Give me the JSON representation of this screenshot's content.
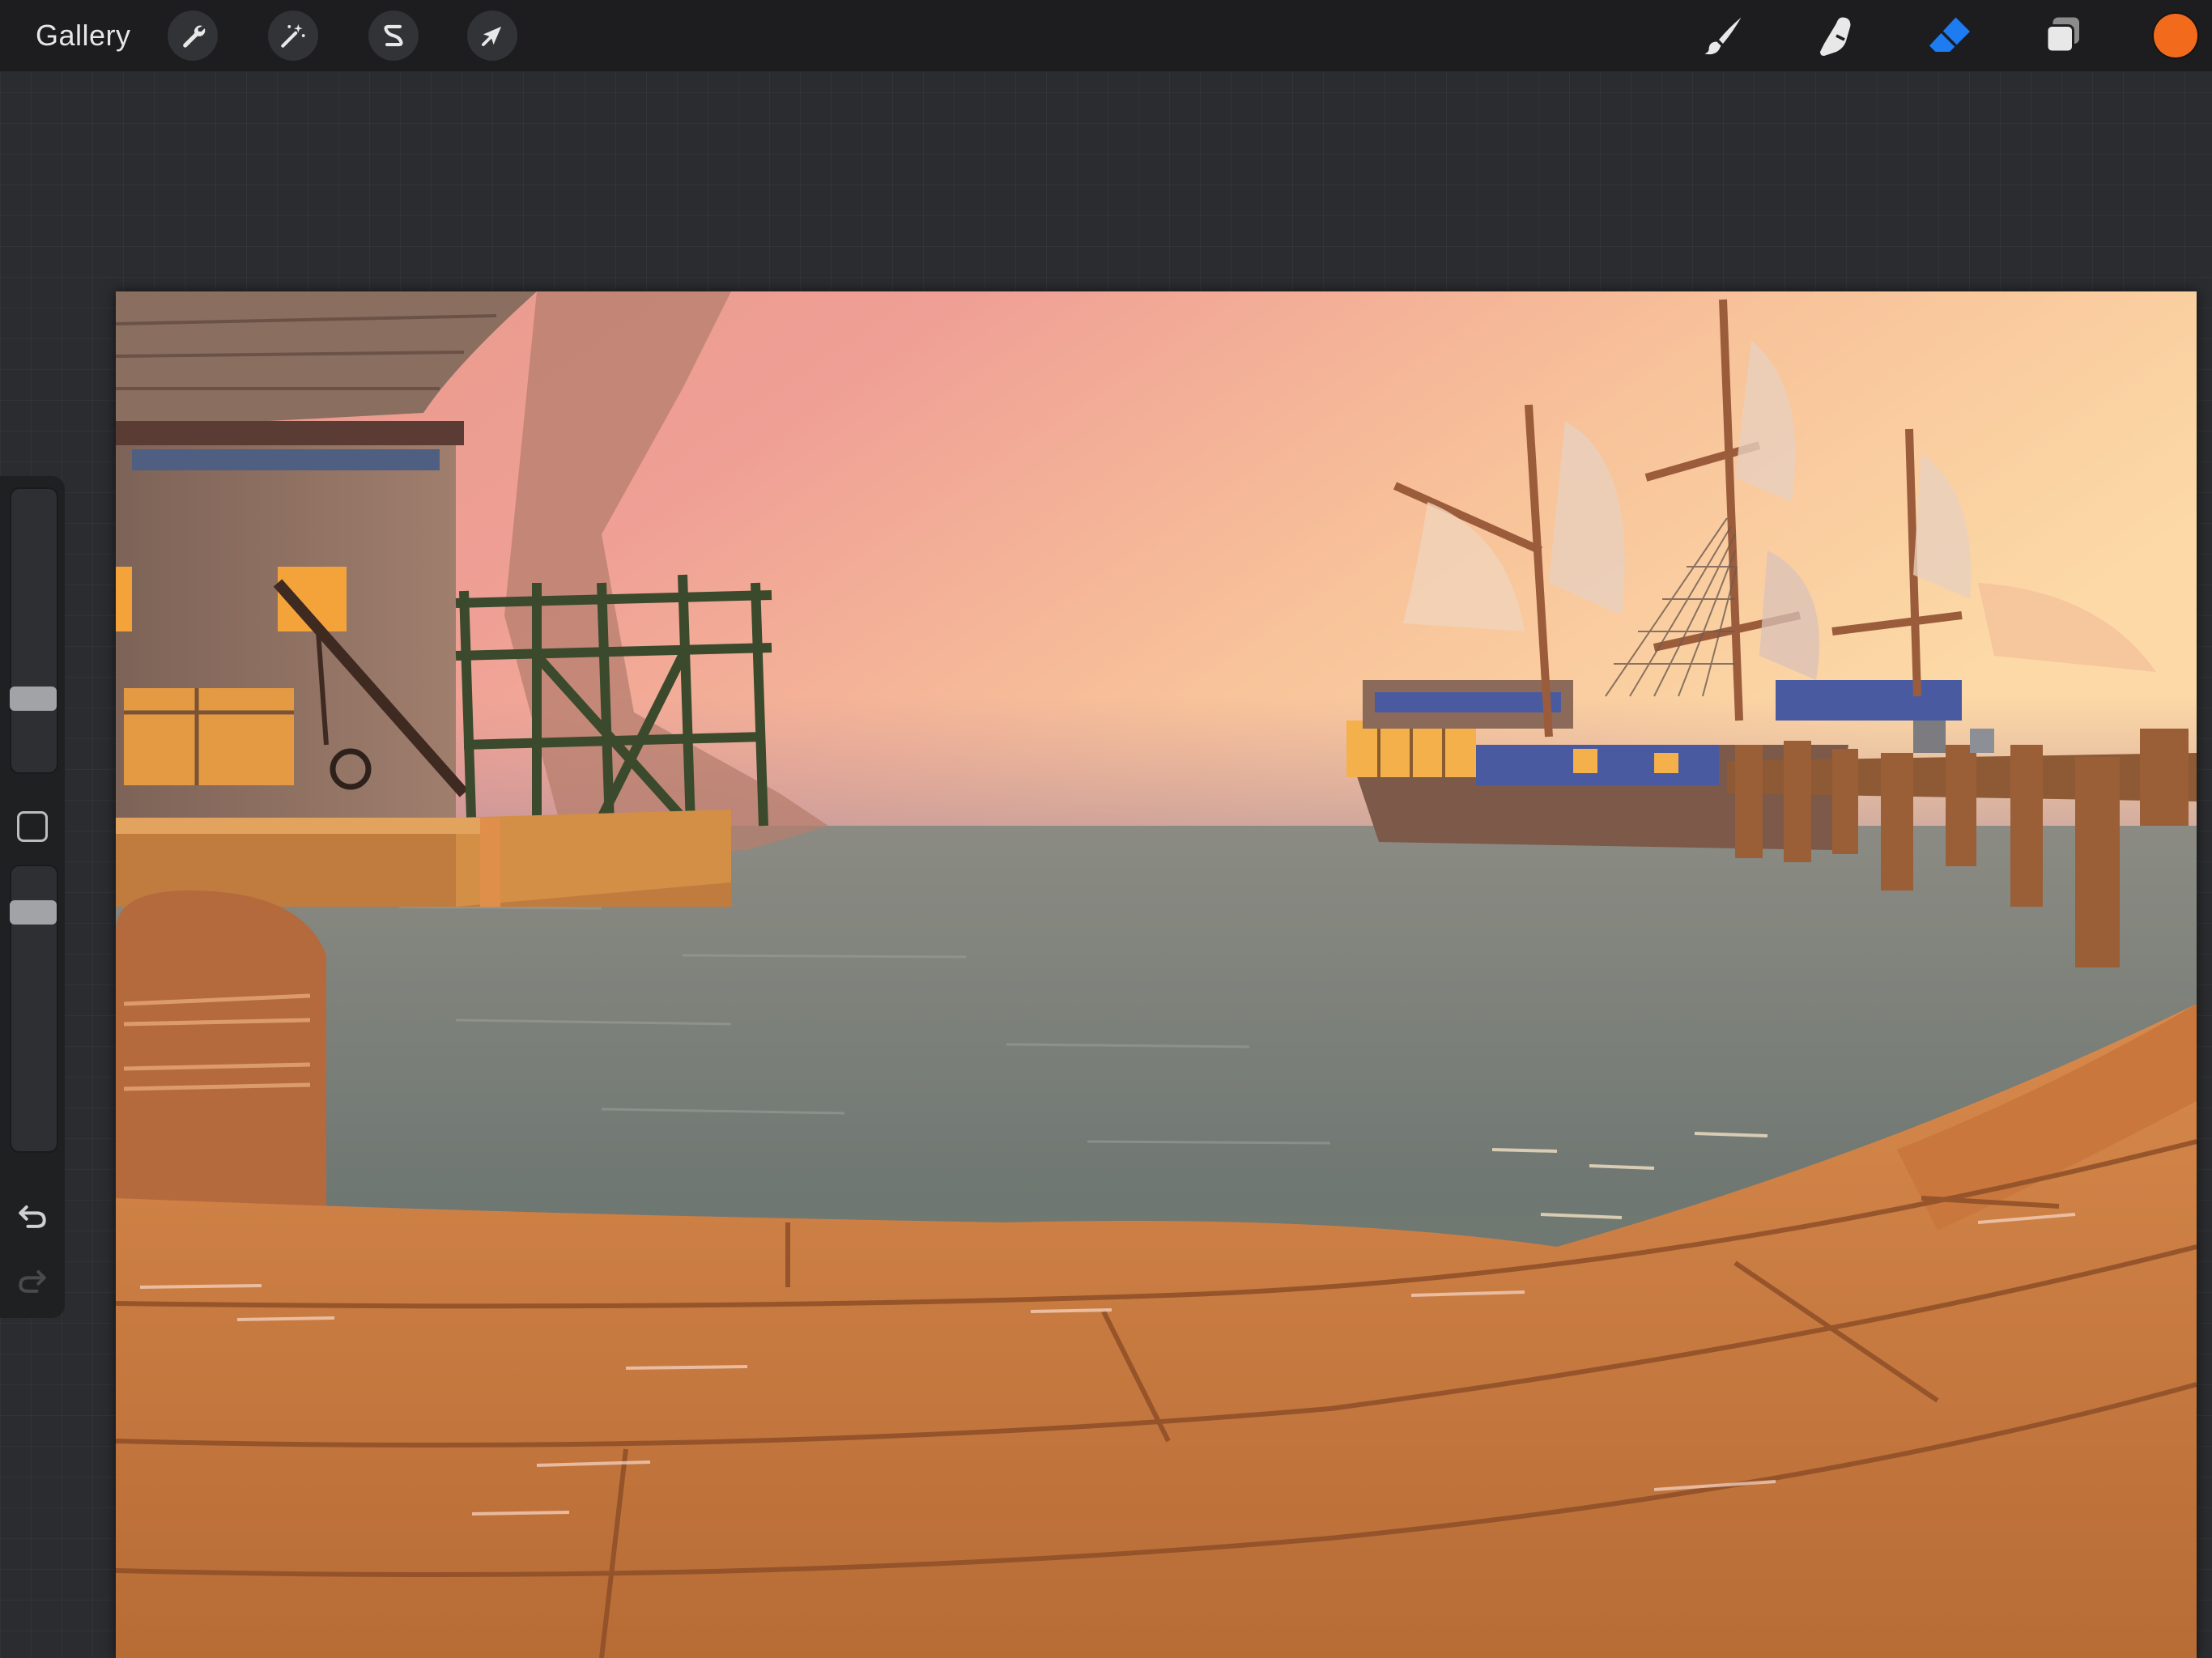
{
  "toolbar": {
    "gallery_label": "Gallery",
    "left_tools": [
      {
        "name": "actions",
        "icon": "wrench-icon"
      },
      {
        "name": "adjustments",
        "icon": "magic-wand-icon"
      },
      {
        "name": "selection",
        "icon": "selection-s-icon"
      },
      {
        "name": "transform",
        "icon": "arrow-cursor-icon"
      }
    ],
    "right_tools": [
      {
        "name": "paint",
        "icon": "brush-icon",
        "active": false
      },
      {
        "name": "smudge",
        "icon": "smudge-finger-icon",
        "active": false
      },
      {
        "name": "erase",
        "icon": "eraser-icon",
        "active": true
      },
      {
        "name": "layers",
        "icon": "layers-icon",
        "active": false
      }
    ],
    "current_color": "#f26a1b",
    "active_tool_color": "#1e7cf2"
  },
  "sidebar": {
    "brush_size_level": 0.25,
    "opacity_level": 0.95,
    "icons": [
      "modify-square-icon",
      "undo-icon",
      "redo-icon"
    ]
  },
  "canvas": {
    "content": "harbor-painting"
  }
}
